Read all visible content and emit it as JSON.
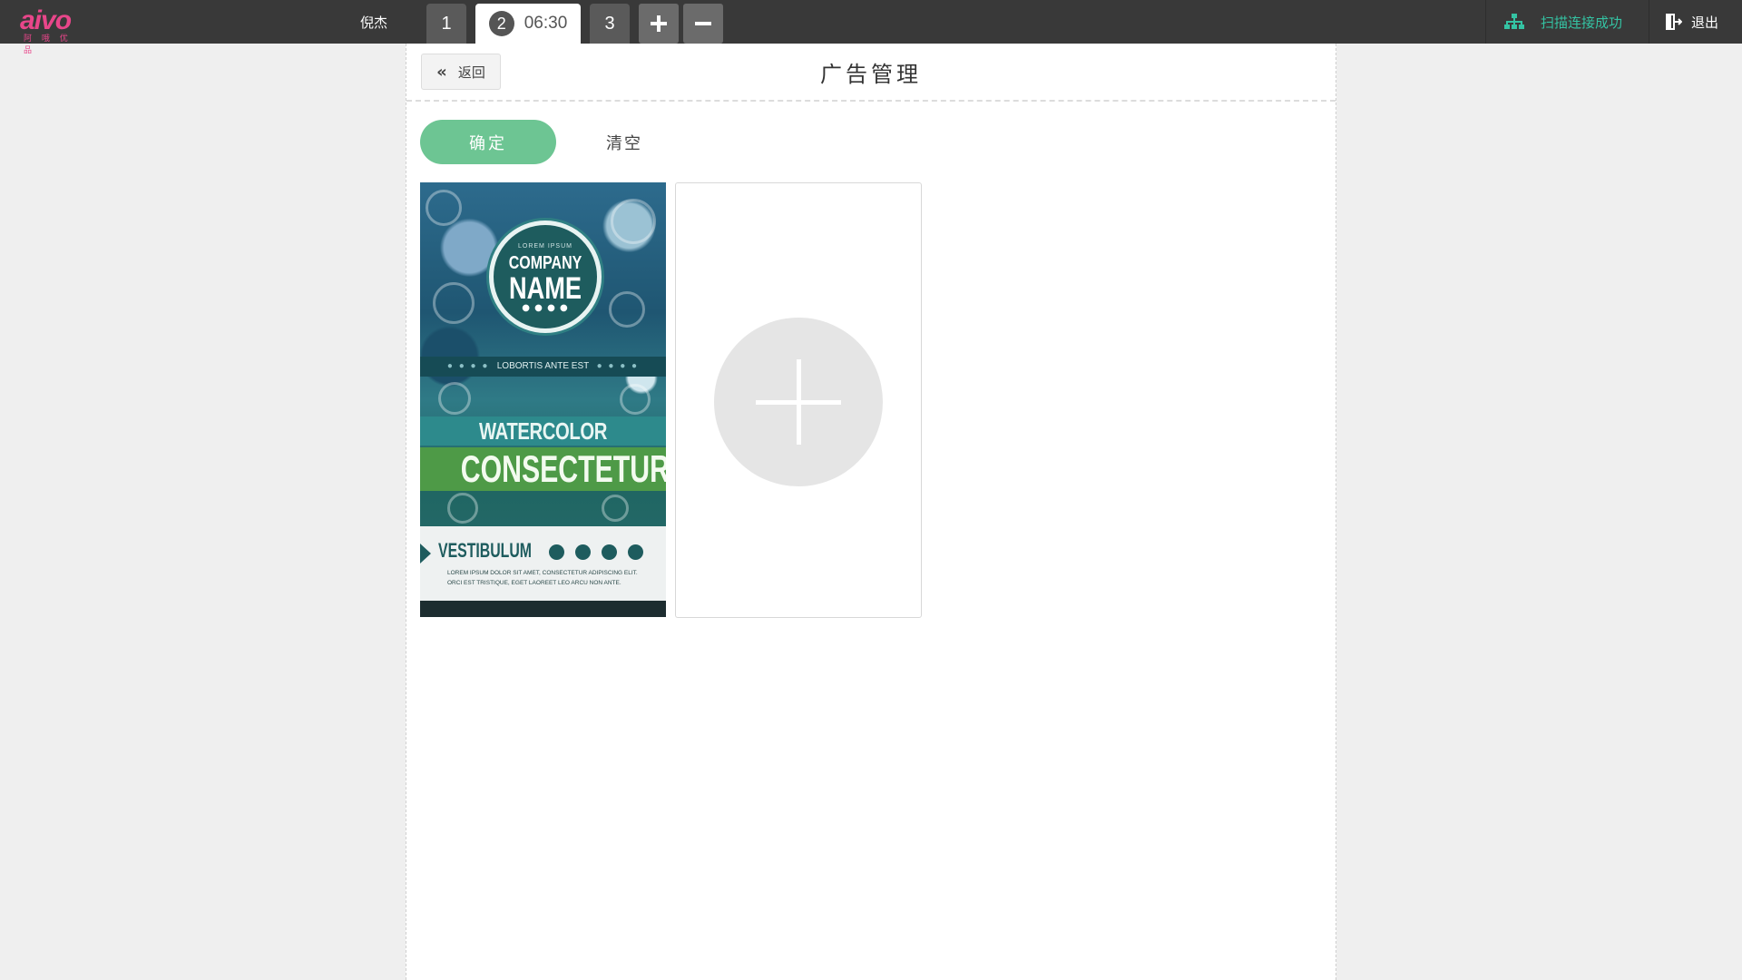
{
  "header": {
    "logo_text": "aivo",
    "logo_sub": "阿 哦 优 品",
    "username": "倪杰",
    "tabs": [
      {
        "label": "1"
      },
      {
        "label": "2",
        "timer": "06:30"
      },
      {
        "label": "3"
      }
    ],
    "add_tab_icon": "plus-icon",
    "remove_tab_icon": "minus-icon",
    "status_text": "扫描连接成功",
    "status_icon": "sitemap-icon",
    "logout_text": "退出",
    "logout_icon": "sign-out-icon",
    "colors": {
      "topbar": "#393939",
      "status": "#34c3a3",
      "logo": "#e8468a"
    }
  },
  "panel": {
    "back_label": "返回",
    "title": "广告管理",
    "confirm_label": "确定",
    "clear_label": "清空",
    "confirm_color": "#6dc593"
  },
  "ad_poster": {
    "lorem": "LOREM IPSUM",
    "company": "COMPANY",
    "name": "NAME",
    "dots": "● ● ● ●",
    "band": "LOBORTIS ANTE EST",
    "band_dots": "● ● ● ●",
    "design": "WATERCOLOR DESIGN",
    "consectetur": "CONSECTETUR",
    "vestibulum": "VESTIBULUM",
    "small_text": "LOREM IPSUM DOLOR SIT AMET, CONSECTETUR ADIPISCING ELIT. ORCI EST TRISTIQUE, EGET LAOREET LEO ARCU NON ANTE."
  },
  "add_card": {
    "icon": "plus-icon"
  }
}
